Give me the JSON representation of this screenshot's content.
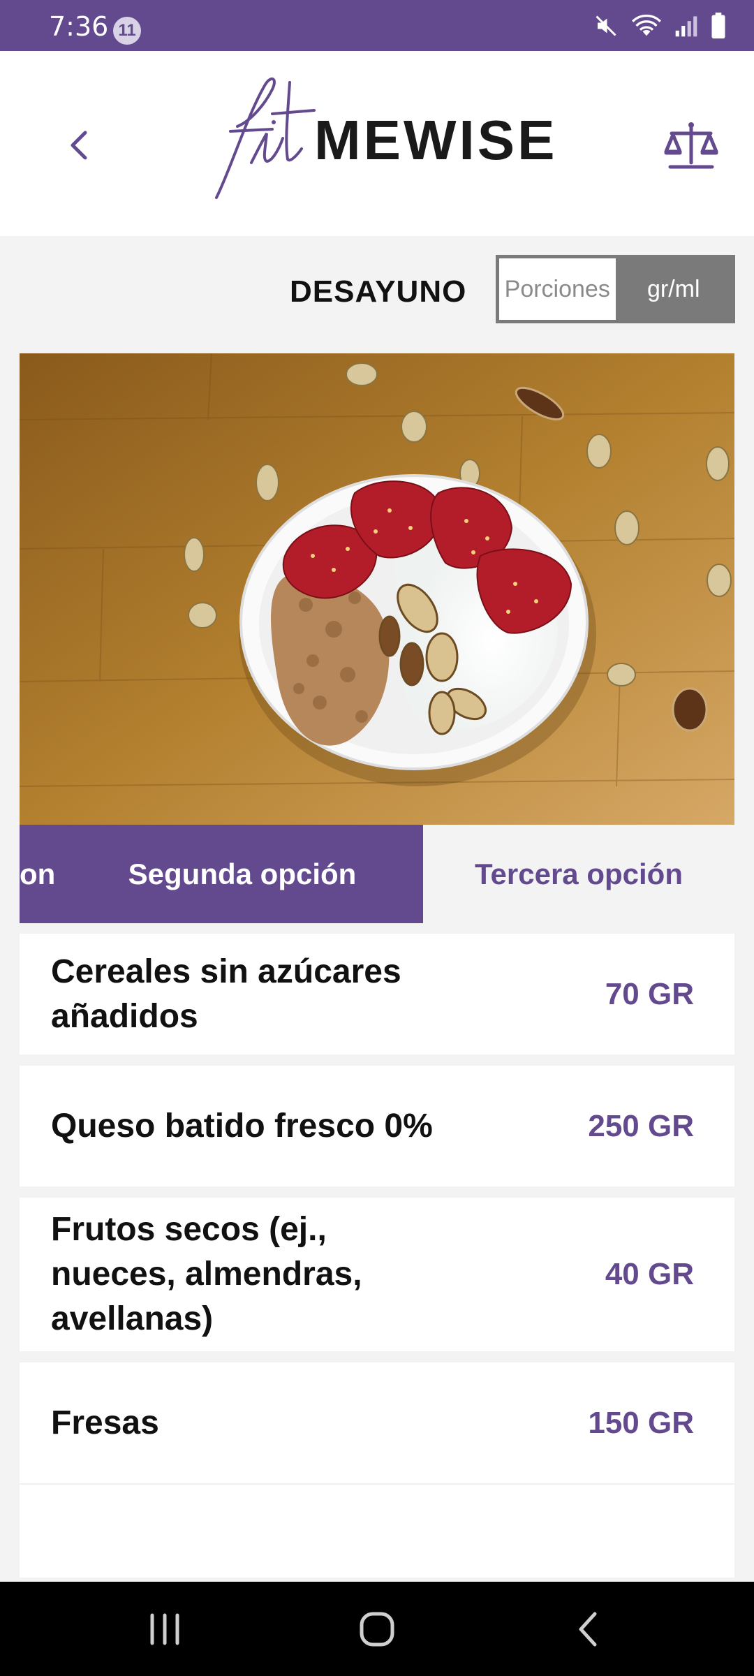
{
  "status_bar": {
    "time": "7:36",
    "notification_count": "11",
    "icons": [
      "mute-icon",
      "wifi-icon",
      "signal-icon",
      "battery-icon"
    ]
  },
  "header": {
    "logo_script": "fit",
    "logo_word": "MEWISE",
    "back_icon": "chevron-left-icon",
    "scale_icon": "scale-icon"
  },
  "meal": {
    "title": "DESAYUNO",
    "unit_toggle": {
      "options": [
        "Porciones",
        "gr/ml"
      ],
      "selected": "gr/ml"
    }
  },
  "tabs": [
    {
      "label": "on",
      "active": false
    },
    {
      "label": "Segunda opción",
      "active": true
    },
    {
      "label": "Tercera opción",
      "active": false
    }
  ],
  "foods": [
    {
      "name": "Cereales sin azúcares añadidos",
      "qty": "70 GR"
    },
    {
      "name": "Queso batido fresco 0%",
      "qty": "250 GR"
    },
    {
      "name": "Frutos secos (ej., nueces, almendras, avellanas)",
      "qty": "40 GR"
    },
    {
      "name": "Fresas",
      "qty": "150 GR"
    }
  ],
  "colors": {
    "brand": "#634a8e",
    "toggle": "#7a7a7a"
  },
  "nav": [
    "recent-apps-icon",
    "home-icon",
    "back-icon"
  ]
}
